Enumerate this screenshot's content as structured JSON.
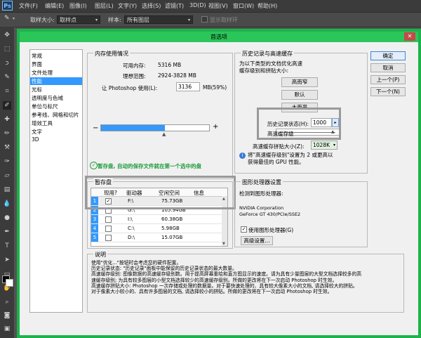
{
  "menubar": {
    "app_logo": "Ps",
    "items": [
      "文件(F)",
      "编辑(E)",
      "图像(I)",
      "图层(L)",
      "文字(Y)",
      "选择(S)",
      "滤镜(T)",
      "3D(D)",
      "视图(V)",
      "窗口(W)",
      "帮助(H)"
    ]
  },
  "optionsbar": {
    "size_label": "取样大小:",
    "size_value": "取样点",
    "sample_label": "样本:",
    "sample_value": "所有图层",
    "ring_label": "显示取样环"
  },
  "dialog": {
    "title": "首选项",
    "nav": [
      "常规",
      "界面",
      "文件处理",
      "性能",
      "光标",
      "透明度与色域",
      "单位与标尺",
      "参考线、网格和切片",
      "增效工具",
      "文字",
      "3D"
    ],
    "nav_selected_index": 3,
    "memory": {
      "title": "内存使用情况",
      "available_label": "可用内存:",
      "available_value": "5316 MB",
      "ideal_label": "理想范围:",
      "ideal_value": "2924-3828 MB",
      "let_label": "让 Photoshop 使用(L):",
      "let_value": "3136",
      "let_unit": "MB(59%)",
      "slider_fraction": 0.59,
      "minus": "−",
      "plus": "+"
    },
    "scratch_notice": "暂存盘, 自动的保存文件就在第一个选中的盘",
    "scratch": {
      "title": "暂存盘",
      "columns": [
        "现用?",
        "驱动器",
        "空闲空间",
        "信息"
      ],
      "rows": [
        {
          "index": "1",
          "active": "✓",
          "drive": "F:\\",
          "free": "75.73GB",
          "info": ""
        },
        {
          "index": "2",
          "active": "",
          "drive": "G:\\",
          "free": "105.94GB",
          "info": ""
        },
        {
          "index": "3",
          "active": "",
          "drive": "I:\\",
          "free": "60.38GB",
          "info": ""
        },
        {
          "index": "4",
          "active": "",
          "drive": "C:\\",
          "free": "5.98GB",
          "info": ""
        },
        {
          "index": "5",
          "active": "",
          "drive": "D:\\",
          "free": "15.07GB",
          "info": ""
        }
      ]
    },
    "history": {
      "title": "历史记录与高速缓存",
      "desc": "为以下类型的文档优化高速缓存级别和拼贴大小:",
      "btn_tall_thin": "高而窄",
      "btn_default": "默认",
      "btn_big_flat": "大而平",
      "states_label": "历史记录状态(H):",
      "states_value": "1000",
      "cache_levels_label": "高速缓存级",
      "cache_tile_label": "高速缓存拼贴大小(Z):",
      "cache_tile_value": "1028K",
      "note": "将\"高速缓存级别\"设置为 2 或更高以获得最佳的 GPU 性能。"
    },
    "gpu": {
      "title": "图形处理器设置",
      "detected_label": "检测到图形处理器:",
      "line1": "NVIDIA Corporation",
      "line2": "GeForce GT 430/PCIe/SSE2",
      "use_label": "使用图形处理器(G)",
      "use_checked": "✓",
      "advanced_btn": "高级设置..."
    },
    "buttons": {
      "ok": "确定",
      "cancel": "取消",
      "prev": "上一个(P)",
      "next": "下一个(N)"
    },
    "explanation": {
      "title": "说明",
      "text": "使用\"优化...\"按钮时会考虑您的硬件配置。\n历史记录状态: \"历史记录\"面板中能保留的历史记录状态的最大数量。\n高速缓存级别: 图像数据的高速缓存级别数。用于提高屏幕重绘和直方图显示的速度。请为具有少量图层的大型文档选择较多的高速缓存级别; 为具有较多图层的小型文档选择较少的高速缓存级别。所做的更改将在下一次启动 Photoshop 时生效。\n高速缓存拼贴大小: Photoshop 一次存储或处理的数据量。对于要快速处理的、具有较大像素大小的文档, 请选择较大的拼贴。对于像素大小较小的、具有许多图层的文档, 请选择较小的拼贴。所做的更改将在下一次启动 Photoshop 时生效。"
    }
  },
  "colors": {
    "dialog_border": "#1db34a",
    "selection": "#3399ff",
    "app_bg": "#535353"
  }
}
